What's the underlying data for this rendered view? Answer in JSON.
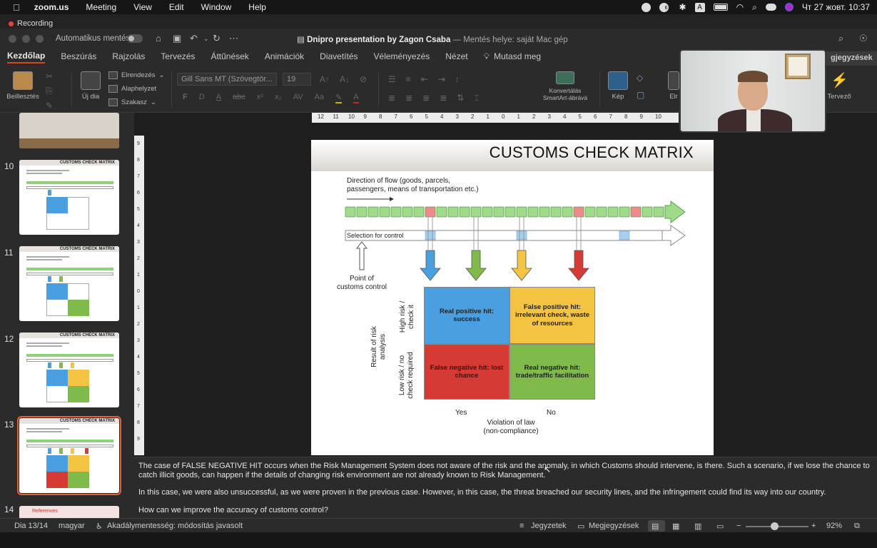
{
  "menubar": {
    "app": "zoom.us",
    "items": [
      "Meeting",
      "View",
      "Edit",
      "Window",
      "Help"
    ],
    "datetime": "Чт 27 жовт.  10:37",
    "badge": "6",
    "input_source": "A"
  },
  "recording": {
    "label": "Recording",
    "color": "#e8453c"
  },
  "titlebar": {
    "autosave": "Automatikus mentés",
    "doc_name": "Dnipro presentation by Zagon Csaba",
    "location": " — Mentés helye: saját Mac gép"
  },
  "tabs": {
    "items": [
      "Kezdőlap",
      "Beszúrás",
      "Rajzolás",
      "Tervezés",
      "Áttűnések",
      "Animációk",
      "Diavetítés",
      "Véleményezés",
      "Nézet"
    ],
    "active": "Kezdőlap",
    "tell_me": "Mutasd meg",
    "comments": "gjegyzések"
  },
  "ribbon": {
    "paste": "Beillesztés",
    "new_slide": "Új dia",
    "layout": "Elrendezés",
    "reset": "Alaphelyzet",
    "section": "Szakasz",
    "font_name": "Gill Sans MT (Szövegtör...",
    "font_size": "19",
    "convert_smartart": "Konvertálás SmartArt-ábrává",
    "picture": "Kép",
    "arrange": "Elr",
    "designer": "Tervező"
  },
  "ruler": {
    "h_ticks": [
      "12",
      "11",
      "10",
      "9",
      "8",
      "7",
      "6",
      "5",
      "4",
      "3",
      "2",
      "1",
      "0",
      "1",
      "2",
      "3",
      "4",
      "5",
      "6",
      "7",
      "8",
      "9",
      "10"
    ],
    "v_ticks": [
      "9",
      "8",
      "7",
      "6",
      "5",
      "4",
      "3",
      "2",
      "1",
      "0",
      "1",
      "2",
      "3",
      "4",
      "5",
      "6",
      "7",
      "8",
      "9"
    ]
  },
  "thumbnails": [
    {
      "num": "10",
      "arrows": [
        "#4a9fe0"
      ],
      "cells": [
        "#4a9fe0"
      ]
    },
    {
      "num": "11",
      "arrows": [
        "#4a9fe0",
        "#7fba4a"
      ],
      "cells": [
        "#4a9fe0",
        "",
        "",
        "#7fba4a"
      ]
    },
    {
      "num": "12",
      "arrows": [
        "#4a9fe0",
        "#7fba4a",
        "#f5c342"
      ],
      "cells": [
        "#4a9fe0",
        "#f5c342",
        "",
        "#7fba4a"
      ]
    },
    {
      "num": "13",
      "arrows": [
        "#4a9fe0",
        "#7fba4a",
        "#f5c342",
        "#d63a34"
      ],
      "cells": [
        "#4a9fe0",
        "#f5c342",
        "#d63a34",
        "#7fba4a"
      ],
      "selected": true
    },
    {
      "num": "14"
    }
  ],
  "thumb_title": "CUSTOMS CHECK MATRIX",
  "thumb_14_label": "References",
  "slide": {
    "title": "CUSTOMS CHECK MATRIX",
    "flow_text": "Direction of flow (goods, parcels,\npassengers, means of transportation etc.)",
    "selection_label": "Selection for control",
    "point_label": "Point of\ncustoms control",
    "flow_cells": [
      "g",
      "g",
      "g",
      "g",
      "g",
      "g",
      "g",
      "r",
      "g",
      "g",
      "g",
      "g",
      "g",
      "g",
      "g",
      "g",
      "g",
      "g",
      "g",
      "g",
      "r",
      "g",
      "g",
      "g",
      "g",
      "r",
      "g",
      "g"
    ],
    "selection_marks": [
      7,
      15,
      24
    ],
    "arrows": [
      {
        "color": "#4a9fe0",
        "col": 7
      },
      {
        "color": "#7fba4a",
        "col": 11
      },
      {
        "color": "#f5c342",
        "col": 15
      },
      {
        "color": "#d63a34",
        "col": 20
      }
    ],
    "matrix": {
      "tl": {
        "text": "Real positive hit:\nsuccess",
        "color": "#4a9fe0"
      },
      "tr": {
        "text": "False positive hit:\nirrelevant check, waste\nof resources",
        "color": "#f5c342"
      },
      "bl": {
        "text": "False negative hit: lost\nchance",
        "color": "#d63a34"
      },
      "br": {
        "text": "Real negative hit:\ntrade/traffic facilitation",
        "color": "#7fba4a"
      }
    },
    "y_axis_title": "Result of risk\nanalysis",
    "y_high": "High risk /\ncheck it",
    "y_low": "Low risk / no\ncheck required",
    "x_yes": "Yes",
    "x_no": "No",
    "x_axis_title": "Violation of law\n(non-compliance)"
  },
  "notes": {
    "p1": "The case of FALSE NEGATIVE HIT occurs when the Risk Management System does not aware of the risk and the anomaly, in which Customs should intervene, is there. Such a scenario, if we lose the chance to catch illicit goods, can happen if the details of changing risk environment are not already known to Risk Management.",
    "p2": "In this case, we were also unsuccessful, as we were proven in the previous case. However, in this case, the threat breached our security lines, and the infringement could find its way into our country.",
    "p3": "How can we improve the accuracy of customs control?"
  },
  "status": {
    "slide": "Dia 13/14",
    "language": "magyar",
    "accessibility": "Akadálymentesség: módosítás javasolt",
    "notes_btn": "Jegyzetek",
    "comments_btn": "Megjegyzések",
    "zoom": "92%"
  }
}
